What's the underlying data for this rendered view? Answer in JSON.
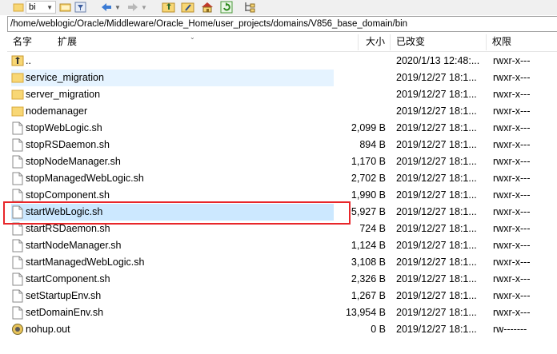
{
  "toolbar": {
    "folder_dropdown": "bi",
    "icons": [
      "folder-icon",
      "folder-open-icon",
      "filter-icon",
      "back-arrow-icon",
      "forward-arrow-icon",
      "parent-folder-icon",
      "new-folder-icon",
      "home-icon",
      "refresh-icon",
      "tree-view-icon"
    ]
  },
  "path": "/home/weblogic/Oracle/Middleware/Oracle_Home/user_projects/domains/V856_base_domain/bin",
  "columns": {
    "name": "名字",
    "ext": "扩展",
    "size": "大小",
    "modified": "已改变",
    "permissions": "权限"
  },
  "files": [
    {
      "name": "..",
      "size": "",
      "modified": "2020/1/13 12:48:...",
      "perm": "rwxr-x---",
      "icon": "parent-dir-icon"
    },
    {
      "name": "service_migration",
      "size": "",
      "modified": "2019/12/27 18:1...",
      "perm": "rwxr-x---",
      "icon": "folder-icon"
    },
    {
      "name": "server_migration",
      "size": "",
      "modified": "2019/12/27 18:1...",
      "perm": "rwxr-x---",
      "icon": "folder-icon"
    },
    {
      "name": "nodemanager",
      "size": "",
      "modified": "2019/12/27 18:1...",
      "perm": "rwxr-x---",
      "icon": "folder-icon"
    },
    {
      "name": "stopWebLogic.sh",
      "size": "2,099 B",
      "modified": "2019/12/27 18:1...",
      "perm": "rwxr-x---",
      "icon": "file-icon"
    },
    {
      "name": "stopRSDaemon.sh",
      "size": "894 B",
      "modified": "2019/12/27 18:1...",
      "perm": "rwxr-x---",
      "icon": "file-icon"
    },
    {
      "name": "stopNodeManager.sh",
      "size": "1,170 B",
      "modified": "2019/12/27 18:1...",
      "perm": "rwxr-x---",
      "icon": "file-icon"
    },
    {
      "name": "stopManagedWebLogic.sh",
      "size": "2,702 B",
      "modified": "2019/12/27 18:1...",
      "perm": "rwxr-x---",
      "icon": "file-icon"
    },
    {
      "name": "stopComponent.sh",
      "size": "1,990 B",
      "modified": "2019/12/27 18:1...",
      "perm": "rwxr-x---",
      "icon": "file-icon"
    },
    {
      "name": "startWebLogic.sh",
      "size": "5,927 B",
      "modified": "2019/12/27 18:1...",
      "perm": "rwxr-x---",
      "icon": "file-icon"
    },
    {
      "name": "startRSDaemon.sh",
      "size": "724 B",
      "modified": "2019/12/27 18:1...",
      "perm": "rwxr-x---",
      "icon": "file-icon"
    },
    {
      "name": "startNodeManager.sh",
      "size": "1,124 B",
      "modified": "2019/12/27 18:1...",
      "perm": "rwxr-x---",
      "icon": "file-icon"
    },
    {
      "name": "startManagedWebLogic.sh",
      "size": "3,108 B",
      "modified": "2019/12/27 18:1...",
      "perm": "rwxr-x---",
      "icon": "file-icon"
    },
    {
      "name": "startComponent.sh",
      "size": "2,326 B",
      "modified": "2019/12/27 18:1...",
      "perm": "rwxr-x---",
      "icon": "file-icon"
    },
    {
      "name": "setStartupEnv.sh",
      "size": "1,267 B",
      "modified": "2019/12/27 18:1...",
      "perm": "rwxr-x---",
      "icon": "file-icon"
    },
    {
      "name": "setDomainEnv.sh",
      "size": "13,954 B",
      "modified": "2019/12/27 18:1...",
      "perm": "rwxr-x---",
      "icon": "file-icon"
    },
    {
      "name": "nohup.out",
      "size": "0 B",
      "modified": "2019/12/27 18:1...",
      "perm": "rw-------",
      "icon": "nohup-file-icon"
    }
  ],
  "colors": {
    "highlight_border": "#e8262a",
    "selection": "#cce8ff",
    "hover": "#e5f3ff",
    "folder": "#f8d775"
  }
}
